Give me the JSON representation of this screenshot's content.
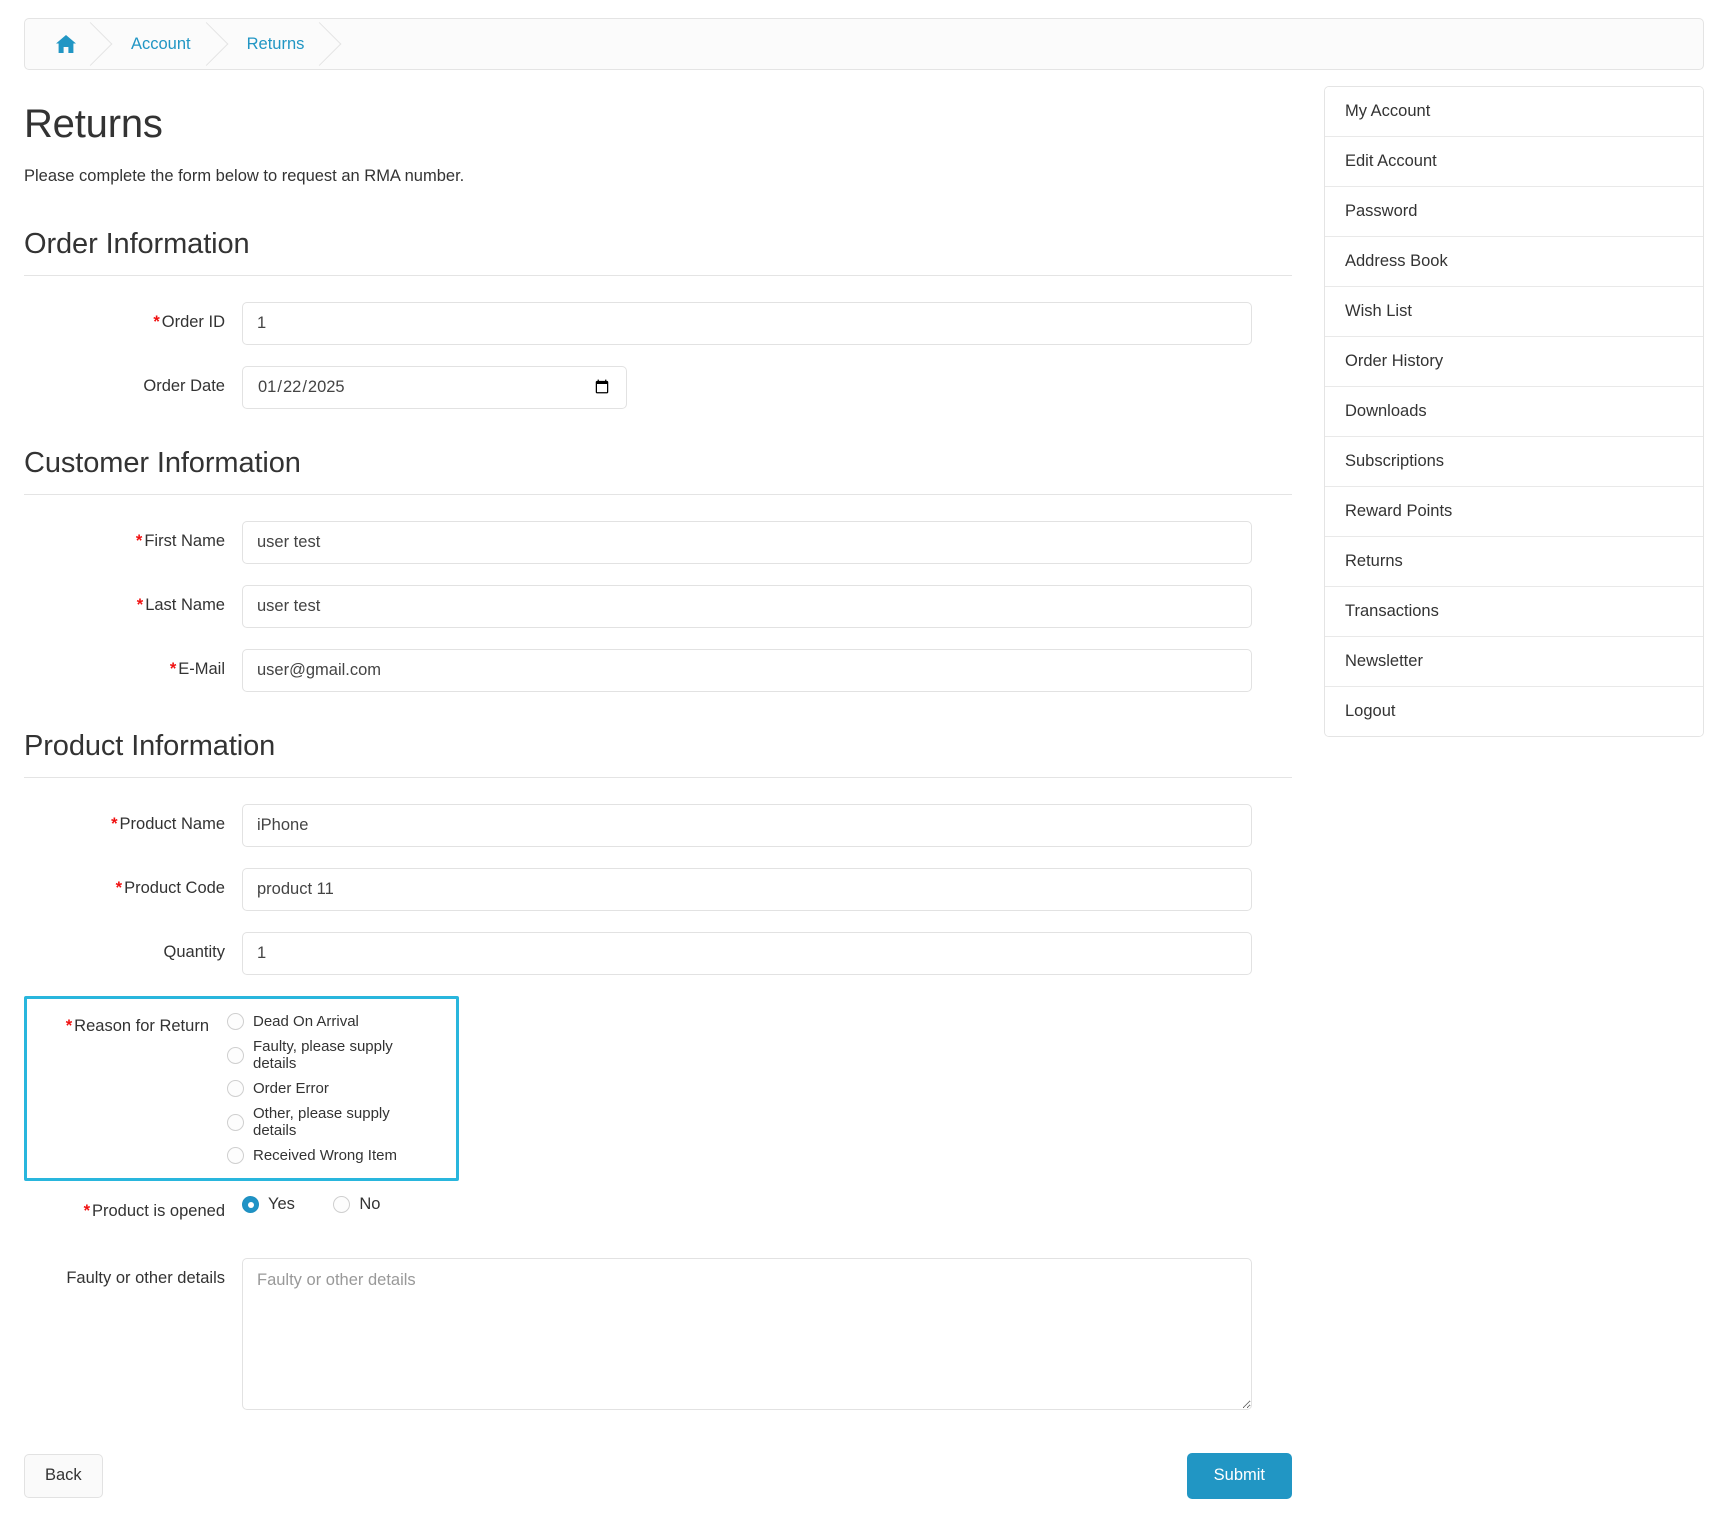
{
  "breadcrumb": {
    "home_icon": "home-icon",
    "items": [
      {
        "label": "Account"
      },
      {
        "label": "Returns"
      }
    ]
  },
  "page": {
    "title": "Returns",
    "intro": "Please complete the form below to request an RMA number."
  },
  "sections": {
    "order": {
      "legend": "Order Information",
      "order_id": {
        "label": "Order ID",
        "required_mark": "*",
        "value": "1",
        "placeholder": "Order ID"
      },
      "order_date": {
        "label": "Order Date",
        "value": "01/22/2025",
        "value_iso": "2025-01-22",
        "calendar_icon": "calendar-icon"
      }
    },
    "customer": {
      "legend": "Customer Information",
      "first_name": {
        "label": "First Name",
        "required_mark": "*",
        "value": "user test",
        "placeholder": "First Name"
      },
      "last_name": {
        "label": "Last Name",
        "required_mark": "*",
        "value": "user test",
        "placeholder": "Last Name"
      },
      "email": {
        "label": "E-Mail",
        "required_mark": "*",
        "value": "user@gmail.com",
        "placeholder": "E-Mail"
      }
    },
    "product": {
      "legend": "Product Information",
      "product_name": {
        "label": "Product Name",
        "required_mark": "*",
        "value": "iPhone",
        "placeholder": "Product Name"
      },
      "product_code": {
        "label": "Product Code",
        "required_mark": "*",
        "value": "product 11",
        "placeholder": "Product Code"
      },
      "quantity": {
        "label": "Quantity",
        "value": "1",
        "placeholder": "Quantity"
      },
      "reason": {
        "label": "Reason for Return",
        "required_mark": "*",
        "highlight_color": "#29b6dd",
        "selected": null,
        "options": [
          {
            "label": "Dead On Arrival",
            "checked": false
          },
          {
            "label": "Faulty, please supply details",
            "checked": false
          },
          {
            "label": "Order Error",
            "checked": false
          },
          {
            "label": "Other, please supply details",
            "checked": false
          },
          {
            "label": "Received Wrong Item",
            "checked": false
          }
        ]
      },
      "opened": {
        "label": "Product is opened",
        "required_mark": "*",
        "selected": "Yes",
        "options": [
          {
            "label": "Yes",
            "checked": true
          },
          {
            "label": "No",
            "checked": false
          }
        ]
      },
      "details": {
        "label": "Faulty or other details",
        "value": "",
        "placeholder": "Faulty or other details"
      }
    }
  },
  "actions": {
    "back_label": "Back",
    "submit_label": "Submit",
    "submit_color": "#2196c4"
  },
  "aside": {
    "items": [
      {
        "label": "My Account"
      },
      {
        "label": "Edit Account"
      },
      {
        "label": "Password"
      },
      {
        "label": "Address Book"
      },
      {
        "label": "Wish List"
      },
      {
        "label": "Order History"
      },
      {
        "label": "Downloads"
      },
      {
        "label": "Subscriptions"
      },
      {
        "label": "Reward Points"
      },
      {
        "label": "Returns"
      },
      {
        "label": "Transactions"
      },
      {
        "label": "Newsletter"
      },
      {
        "label": "Logout"
      }
    ]
  }
}
